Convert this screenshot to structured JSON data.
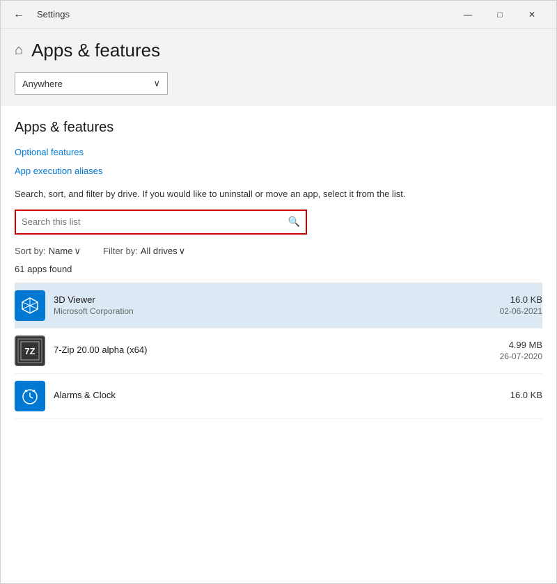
{
  "titleBar": {
    "title": "Settings",
    "backArrow": "←",
    "minimizeBtn": "—",
    "maximizeBtn": "□",
    "closeBtn": "✕"
  },
  "pageHeader": {
    "homeIcon": "⌂",
    "title": "Apps & features"
  },
  "dropdown": {
    "label": "Anywhere",
    "chevron": "∨"
  },
  "section": {
    "title": "Apps & features",
    "optionalFeaturesLink": "Optional features",
    "appExecutionLink": "App execution aliases",
    "description": "Search, sort, and filter by drive. If you would like to uninstall or move an app, select it from the list."
  },
  "search": {
    "placeholder": "Search this list",
    "icon": "🔍"
  },
  "sortFilter": {
    "sortLabel": "Sort by:",
    "sortValue": "Name",
    "sortChevron": "∨",
    "filterLabel": "Filter by:",
    "filterValue": "All drives",
    "filterChevron": "∨"
  },
  "appsCount": {
    "text": "61 apps found"
  },
  "apps": [
    {
      "name": "3D Viewer",
      "publisher": "Microsoft Corporation",
      "size": "16.0 KB",
      "date": "02-06-2021",
      "iconType": "3d",
      "iconText": "⬡",
      "highlighted": true
    },
    {
      "name": "7-Zip 20.00 alpha (x64)",
      "publisher": "",
      "size": "4.99 MB",
      "date": "26-07-2020",
      "iconType": "7zip",
      "iconText": "7Z",
      "highlighted": false
    },
    {
      "name": "Alarms & Clock",
      "publisher": "",
      "size": "16.0 KB",
      "date": "",
      "iconType": "alarms",
      "iconText": "⏰",
      "highlighted": false
    }
  ]
}
